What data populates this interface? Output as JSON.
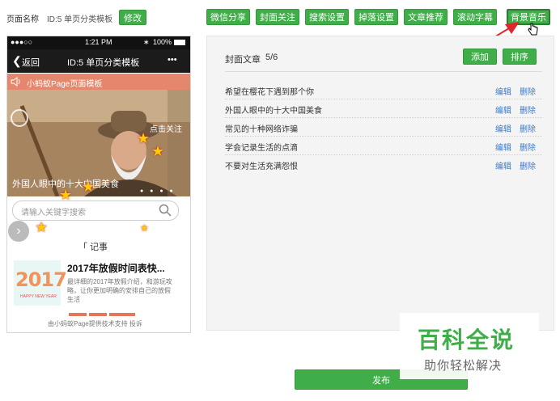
{
  "header": {
    "page_name_label": "页面名称",
    "page_name_value": "ID:5 单页分类模板",
    "edit_button": "修改"
  },
  "toolbar": {
    "buttons": [
      "微信分享",
      "封面关注",
      "搜索设置",
      "掉落设置",
      "文章推荐",
      "滚动字幕",
      "背景音乐"
    ]
  },
  "phone": {
    "status": {
      "signal": "●●●○○",
      "time": "1:21 PM",
      "battery": "100%"
    },
    "nav": {
      "back": "返回",
      "title": "ID:5 单页分类模板",
      "more": "•••"
    },
    "music_title": "小蚂蚁Page页面模板",
    "banner_caption": "外国人眼中的十大中国美食",
    "banner_follow": "点击关注",
    "search_placeholder": "请输入关键字搜索",
    "section_title": "「 记事",
    "article": {
      "title": "2017年放假时间表快...",
      "desc": "最详细的2017年放假介绍，和游玩攻略，让你更加明确的安排自己的放假生活",
      "thumb_text": "2017",
      "thumb_sub": "HAPPY NEW YEAR"
    },
    "footer": "由小蚂蚁Page提供技术支持  投诉"
  },
  "panel": {
    "heading": "封面文章",
    "count": "5/6",
    "add_button": "添加",
    "sort_button": "排序",
    "edit_label": "编辑",
    "delete_label": "删除",
    "articles": [
      "希望在樱花下遇到那个你",
      "外国人眼中的十大中国美食",
      "常见的十种网络诈骗",
      "学会记录生活的点滴",
      "不要对生活充满怨恨"
    ]
  },
  "publish_button": "发布",
  "watermark": {
    "title": "百科全说",
    "subtitle": "助你轻松解决"
  },
  "colors": {
    "accent": "#3fae49",
    "music_bar": "#e5876d",
    "link": "#3b7bc9",
    "arrow": "#e3262b"
  }
}
